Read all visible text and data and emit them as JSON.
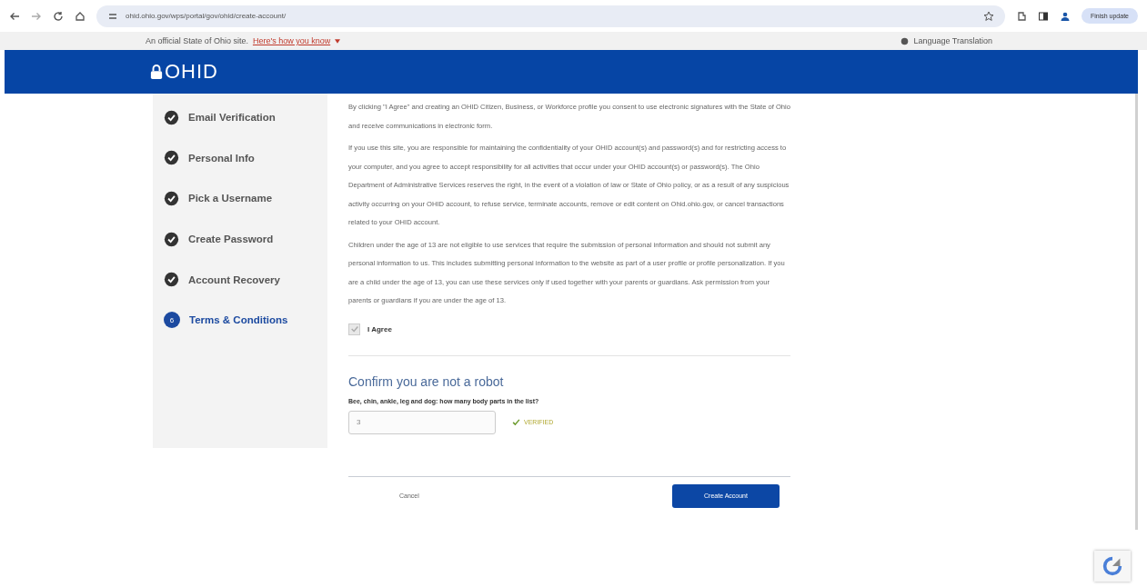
{
  "browser": {
    "url": "ohid.ohio.gov/wps/portal/gov/ohid/create-account/",
    "update_button": "Finish update"
  },
  "banner": {
    "official_text": "An official State of Ohio site.",
    "how_link": "Here's how you know",
    "language": "Language Translation"
  },
  "header": {
    "logo": "OHID"
  },
  "steps": [
    {
      "label": "Email Verification",
      "kind": "done",
      "selected": false
    },
    {
      "label": "Personal Info",
      "kind": "done",
      "selected": false
    },
    {
      "label": "Pick a Username",
      "kind": "done",
      "selected": false
    },
    {
      "label": "Create Password",
      "kind": "done",
      "selected": false
    },
    {
      "label": "Account Recovery",
      "kind": "done",
      "selected": false
    },
    {
      "label": "Terms & Conditions",
      "kind": "current",
      "number": "6",
      "selected": true
    }
  ],
  "terms": [
    "By clicking \"I Agree\" and creating an OHID Citizen, Business, or Workforce profile you consent to use electronic signatures with the State of Ohio and receive communications in electronic form.",
    "If you use this site, you are responsible for maintaining the confidentiality of your OHID account(s) and password(s) and for restricting access to your computer, and you agree to accept responsibility for all activities that occur under your OHID account(s) or password(s). The Ohio Department of Administrative Services reserves the right, in the event of a violation of law or State of Ohio policy, or as a result of any suspicious activity occurring on your OHID account, to refuse service, terminate accounts, remove or edit content on Ohid.ohio.gov, or cancel transactions related to your OHID account.",
    "Children under the age of 13 are not eligible to use services that require the submission of personal information and should not submit any personal information to us. This includes submitting personal information to the website as part of a user profile or profile personalization. If you are a child under the age of 13, you can use these services only if used together with your parents or guardians. Ask permission from your parents or guardians if you are under the age of 13."
  ],
  "agree": {
    "label": "I Agree",
    "checked": true,
    "disabled": true
  },
  "robot": {
    "title": "Confirm you are not a robot",
    "question": "Bee, chin, ankle, leg and dog: how many body parts in the list?",
    "answer": "3",
    "verified": true,
    "status": "VERIFIED"
  },
  "actions": {
    "cancel": "Cancel",
    "submit": "Create Account"
  }
}
